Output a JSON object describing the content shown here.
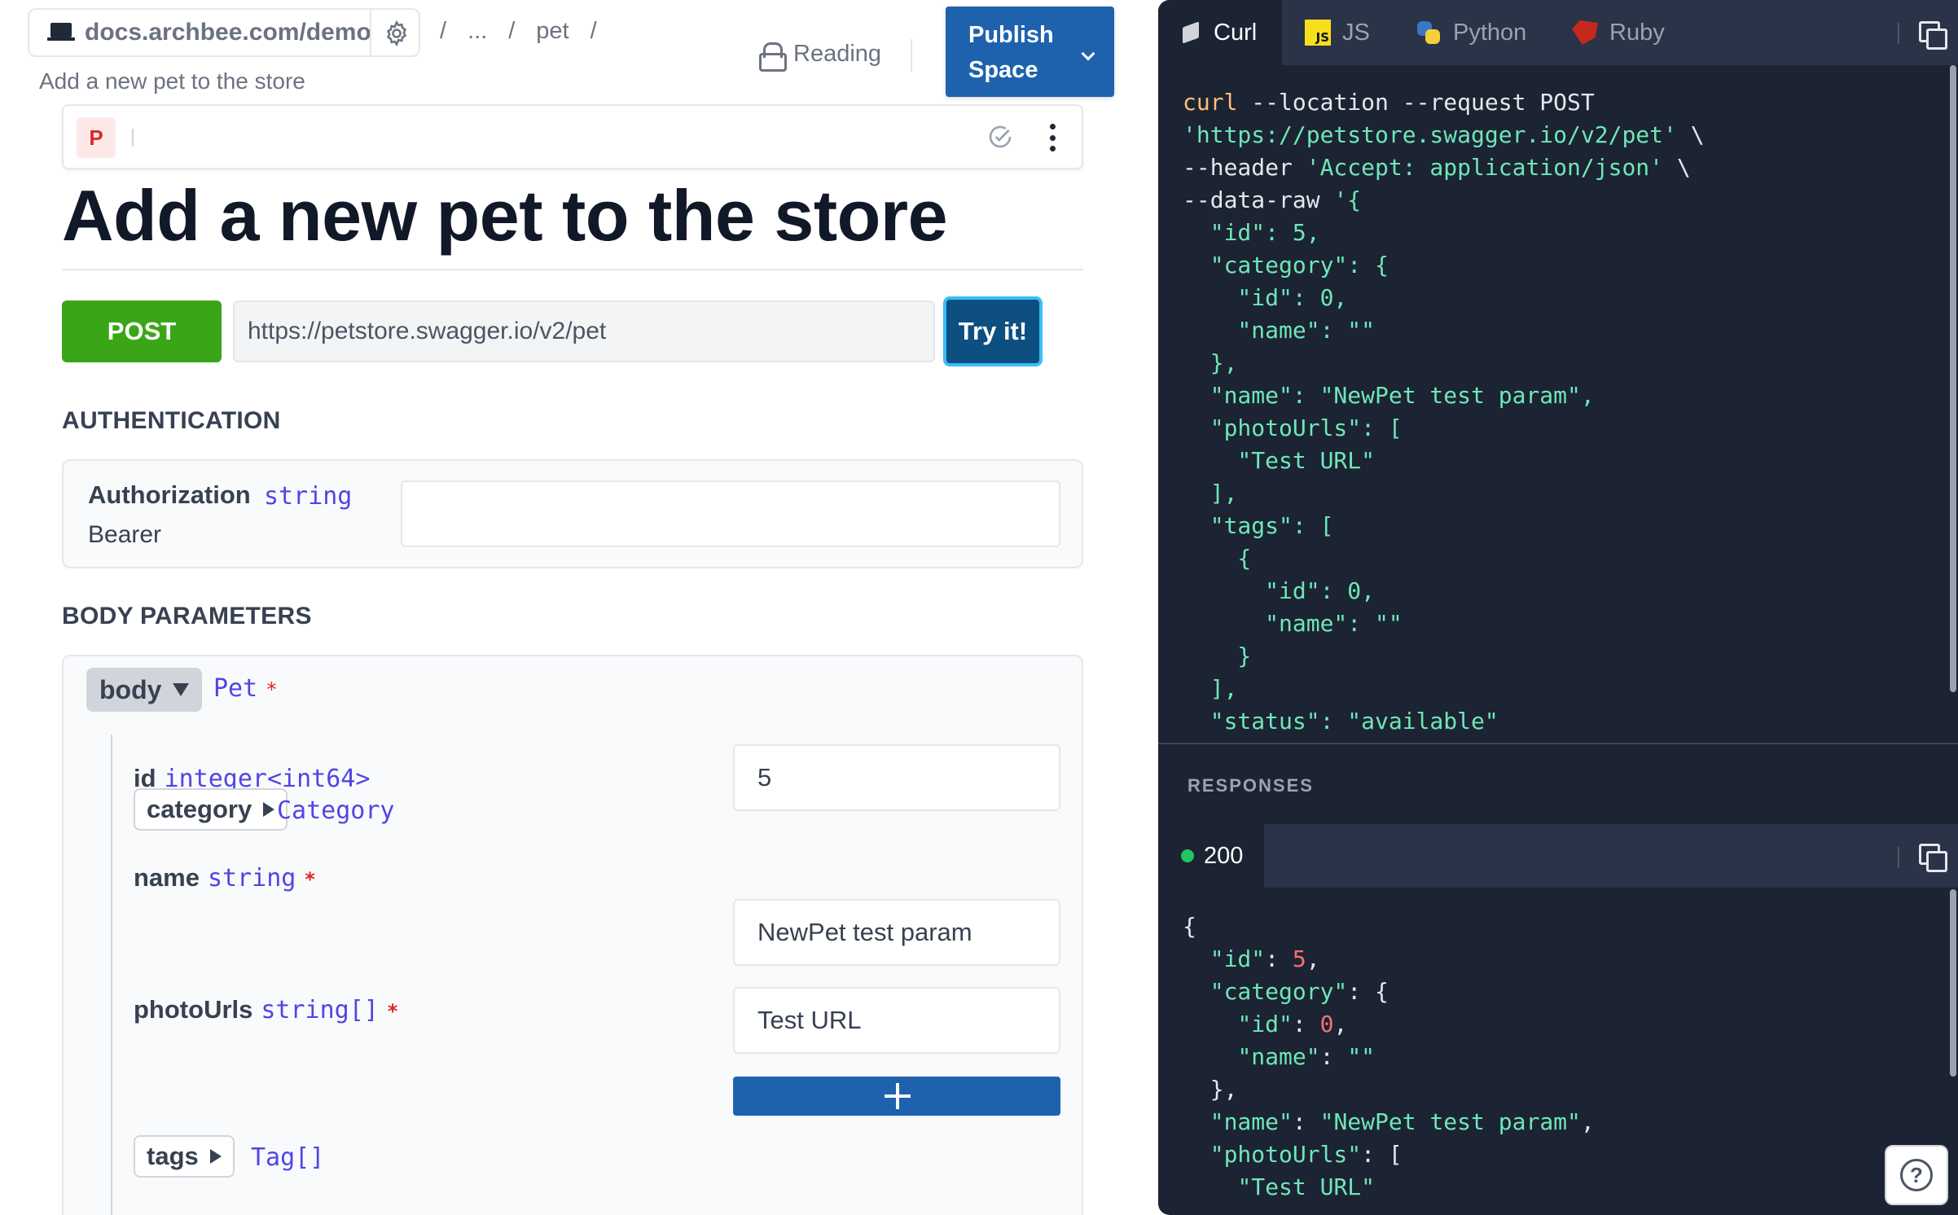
{
  "header": {
    "site_url": "docs.archbee.com/demo",
    "breadcrumbs": [
      "/",
      "...",
      "/",
      "pet",
      "/"
    ],
    "subtitle": "Add a new pet to the store",
    "reading_label": "Reading",
    "publish_line1": "Publish",
    "publish_line2": "Space"
  },
  "editor": {
    "badge": "P"
  },
  "page": {
    "title": "Add a new pet to the store",
    "method": "POST",
    "url": "https://petstore.swagger.io/v2/pet",
    "try_label": "Try it!"
  },
  "authentication": {
    "heading": "AUTHENTICATION",
    "name": "Authorization",
    "type": "string",
    "sub": "Bearer",
    "value": ""
  },
  "body_params": {
    "heading": "BODY PARAMETERS",
    "body_label": "body",
    "body_type": "Pet",
    "required_mark": "*",
    "fields": {
      "id": {
        "name": "id",
        "type": "integer<int64>",
        "value": "5"
      },
      "category": {
        "name": "category",
        "type": "Category"
      },
      "name": {
        "name": "name",
        "type": "string",
        "value": "NewPet test param"
      },
      "photoUrls": {
        "name": "photoUrls",
        "type": "string[]",
        "value": "Test URL"
      },
      "tags": {
        "name": "tags",
        "type": "Tag[]"
      }
    }
  },
  "code_panel": {
    "tabs": [
      {
        "label": "Curl",
        "icon": "curl-cube-icon"
      },
      {
        "label": "JS",
        "icon": "js-icon"
      },
      {
        "label": "Python",
        "icon": "python-icon"
      },
      {
        "label": "Ruby",
        "icon": "ruby-icon"
      }
    ],
    "js_icon_text": "JS",
    "active_tab": "Curl",
    "request_code": {
      "l1": "curl",
      "l1b": " --location --request POST",
      "l2": "'https://petstore.swagger.io/v2/pet'",
      "l2b": " \\",
      "l3": "--header ",
      "l3b": "'Accept: application/json'",
      "l3c": " \\",
      "l4": "--data-raw ",
      "l4b": "'{"
    },
    "responses_label": "RESPONSES",
    "response_status": "200"
  },
  "colors": {
    "post_green": "#3aa617",
    "publish_blue": "#1e62ad",
    "code_bg": "#1c2333",
    "type_indigo": "#4f46e5"
  }
}
